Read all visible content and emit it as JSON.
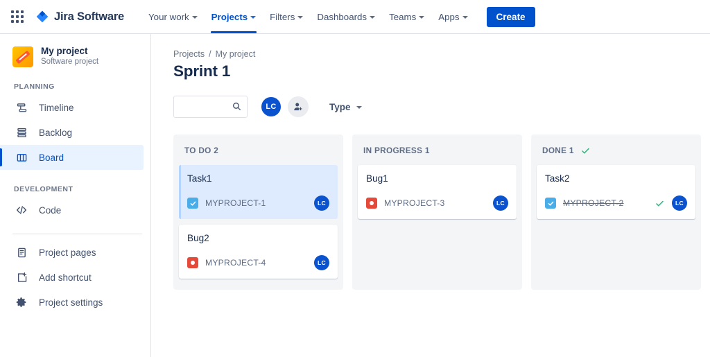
{
  "topnav": {
    "appswitcher_label": "app-switcher",
    "brand": "Jira Software",
    "items": [
      {
        "label": "Your work",
        "has_caret": true,
        "active": false
      },
      {
        "label": "Projects",
        "has_caret": true,
        "active": true
      },
      {
        "label": "Filters",
        "has_caret": true,
        "active": false
      },
      {
        "label": "Dashboards",
        "has_caret": true,
        "active": false
      },
      {
        "label": "Teams",
        "has_caret": true,
        "active": false
      },
      {
        "label": "Apps",
        "has_caret": true,
        "active": false
      }
    ],
    "create_label": "Create",
    "accent_color": "#0052CC"
  },
  "sidebar": {
    "project_name": "My project",
    "project_type": "Software project",
    "sections": [
      {
        "label": "PLANNING",
        "items": [
          {
            "label": "Timeline",
            "icon": "timeline-icon",
            "active": false
          },
          {
            "label": "Backlog",
            "icon": "backlog-icon",
            "active": false
          },
          {
            "label": "Board",
            "icon": "board-icon",
            "active": true
          }
        ]
      },
      {
        "label": "DEVELOPMENT",
        "items": [
          {
            "label": "Code",
            "icon": "code-icon",
            "active": false
          }
        ]
      }
    ],
    "footer_items": [
      {
        "label": "Project pages",
        "icon": "page-icon"
      },
      {
        "label": "Add shortcut",
        "icon": "add-shortcut-icon"
      },
      {
        "label": "Project settings",
        "icon": "gear-icon"
      }
    ],
    "active_bg": "#E9F2FF",
    "active_color": "#0052CC"
  },
  "main": {
    "breadcrumb": {
      "parent": "Projects",
      "separator": "/",
      "current": "My project"
    },
    "title": "Sprint 1",
    "toolbar": {
      "search_value": "",
      "search_placeholder": "",
      "search_icon": "search-icon",
      "avatar_initials": "LC",
      "avatar_color": "#0B52CE",
      "add_people_icon": "add-person-icon",
      "type_filter_label": "Type"
    }
  },
  "board": {
    "columns": [
      {
        "name": "TO DO",
        "count": "2",
        "header": "TO DO 2",
        "has_check": false,
        "cards": [
          {
            "title": "Task1",
            "key": "MYPROJECT-1",
            "type": "task",
            "selected": true,
            "done": false,
            "assignee": "LC"
          },
          {
            "title": "Bug2",
            "key": "MYPROJECT-4",
            "type": "bug",
            "selected": false,
            "done": false,
            "assignee": "LC"
          }
        ]
      },
      {
        "name": "IN PROGRESS",
        "count": "1",
        "header": "IN PROGRESS 1",
        "has_check": false,
        "cards": [
          {
            "title": "Bug1",
            "key": "MYPROJECT-3",
            "type": "bug",
            "selected": false,
            "done": false,
            "assignee": "LC"
          }
        ]
      },
      {
        "name": "DONE",
        "count": "1",
        "header": "DONE 1",
        "has_check": true,
        "cards": [
          {
            "title": "Task2",
            "key": "MYPROJECT-2",
            "type": "task",
            "selected": false,
            "done": true,
            "assignee": "LC"
          }
        ]
      }
    ],
    "column_bg": "#F4F5F7",
    "done_color": "#36B37E",
    "task_color": "#4BADE8",
    "bug_color": "#E5493A",
    "selected_card_bg": "#DEEBFF"
  }
}
